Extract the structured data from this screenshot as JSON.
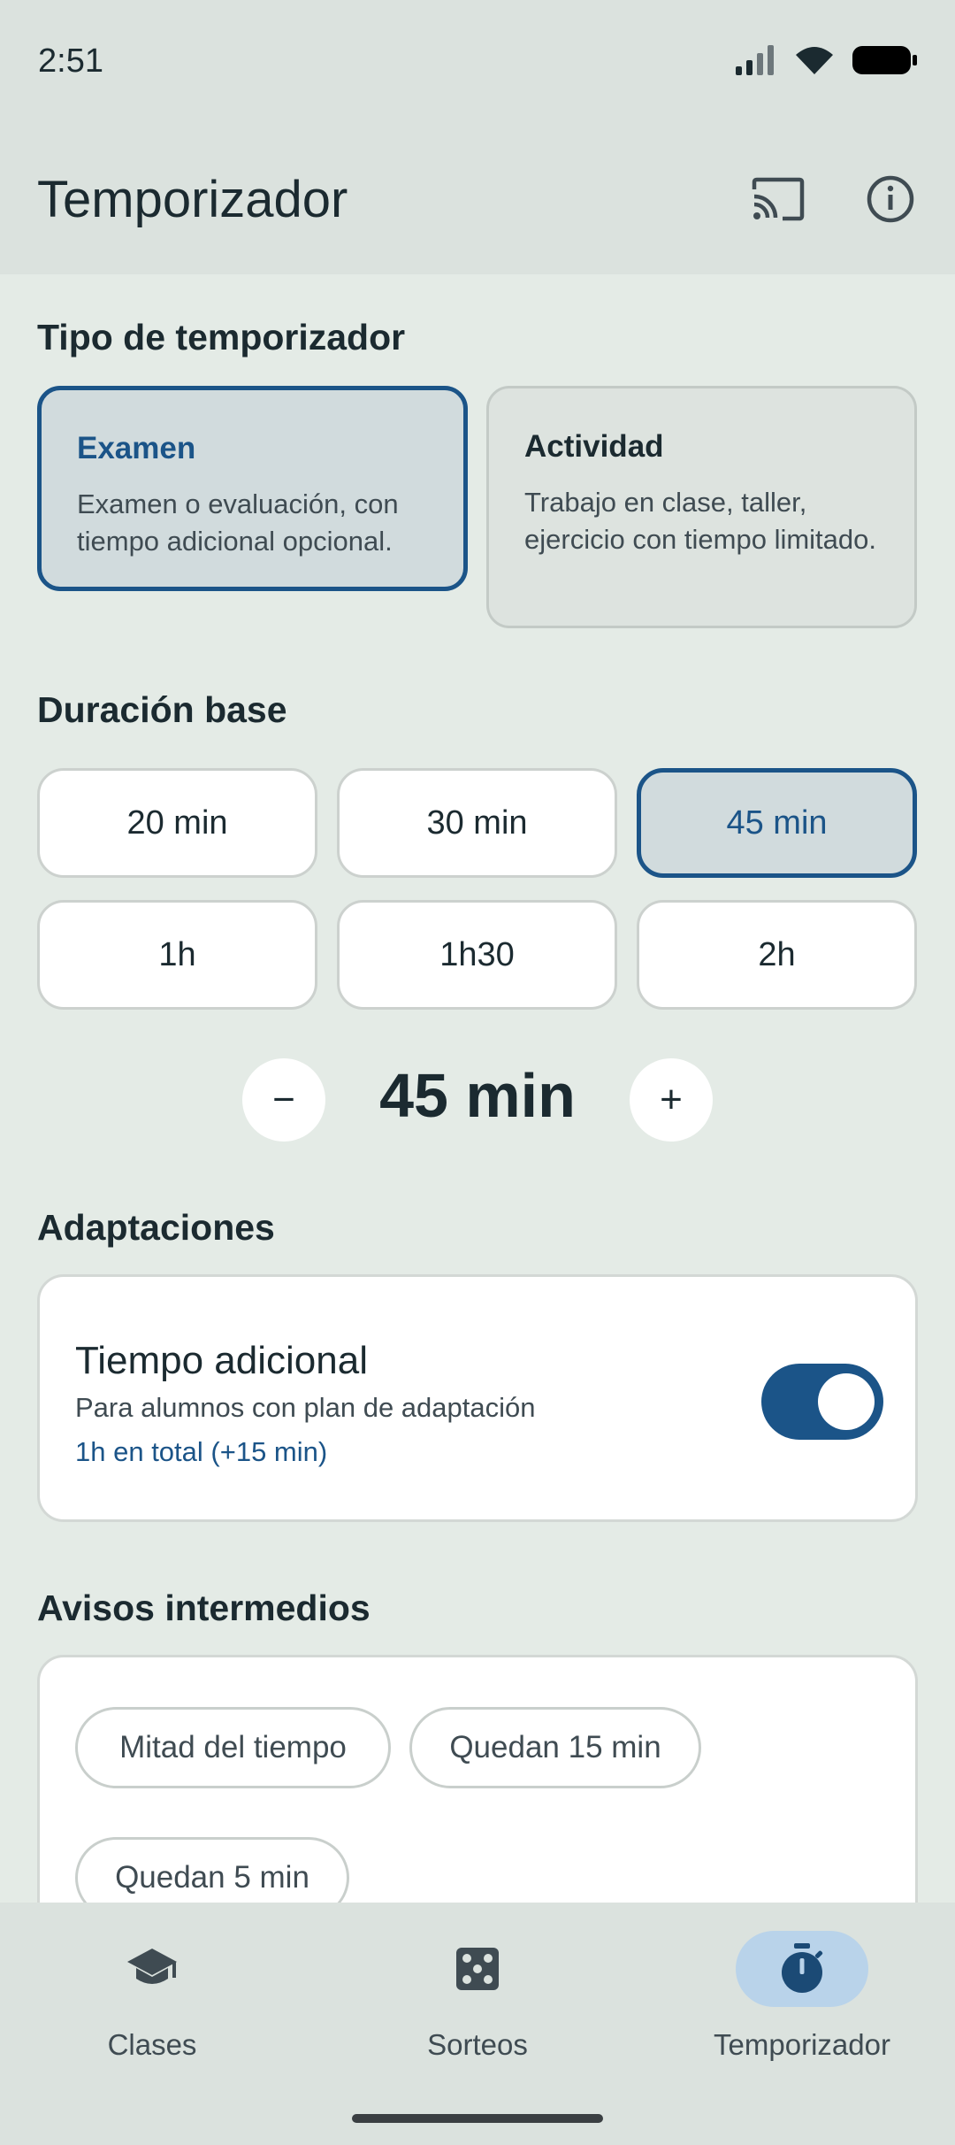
{
  "status_bar": {
    "time": "2:51"
  },
  "app_bar": {
    "title": "Temporizador",
    "actions": [
      {
        "icon": "cast-icon"
      },
      {
        "icon": "info-icon"
      }
    ]
  },
  "timer_type": {
    "title": "Tipo de temporizador",
    "options": [
      {
        "title": "Examen",
        "description": "Examen o evaluación, con tiempo adicional opcional.",
        "selected": true
      },
      {
        "title": "Actividad",
        "description": "Trabajo en clase, taller, ejercicio con tiempo limitado.",
        "selected": false
      }
    ]
  },
  "duration": {
    "title": "Duración base",
    "options": [
      "20 min",
      "30 min",
      "45 min",
      "1h",
      "1h30",
      "2h"
    ],
    "selected": "45 min",
    "current": "45 min",
    "decrement_label": "−",
    "increment_label": "+"
  },
  "adaptations": {
    "title": "Adaptaciones",
    "extra_time": {
      "title": "Tiempo adicional",
      "subtitle": "Para alumnos con plan de adaptación",
      "total": "1h en total (+15 min)",
      "enabled": true
    }
  },
  "warnings": {
    "title": "Avisos intermedios",
    "chips": [
      "Mitad del tiempo",
      "Quedan 15 min",
      "Quedan 5 min"
    ]
  },
  "bottom_nav": {
    "items": [
      {
        "label": "Clases",
        "icon": "school-icon",
        "active": false
      },
      {
        "label": "Sorteos",
        "icon": "dice-icon",
        "active": false
      },
      {
        "label": "Temporizador",
        "icon": "timer-icon",
        "active": true
      }
    ]
  },
  "colors": {
    "accent": "#1b5488",
    "background": "#e4ebe6",
    "surface": "#ffffff",
    "nav_active": "#b9d3ea"
  }
}
